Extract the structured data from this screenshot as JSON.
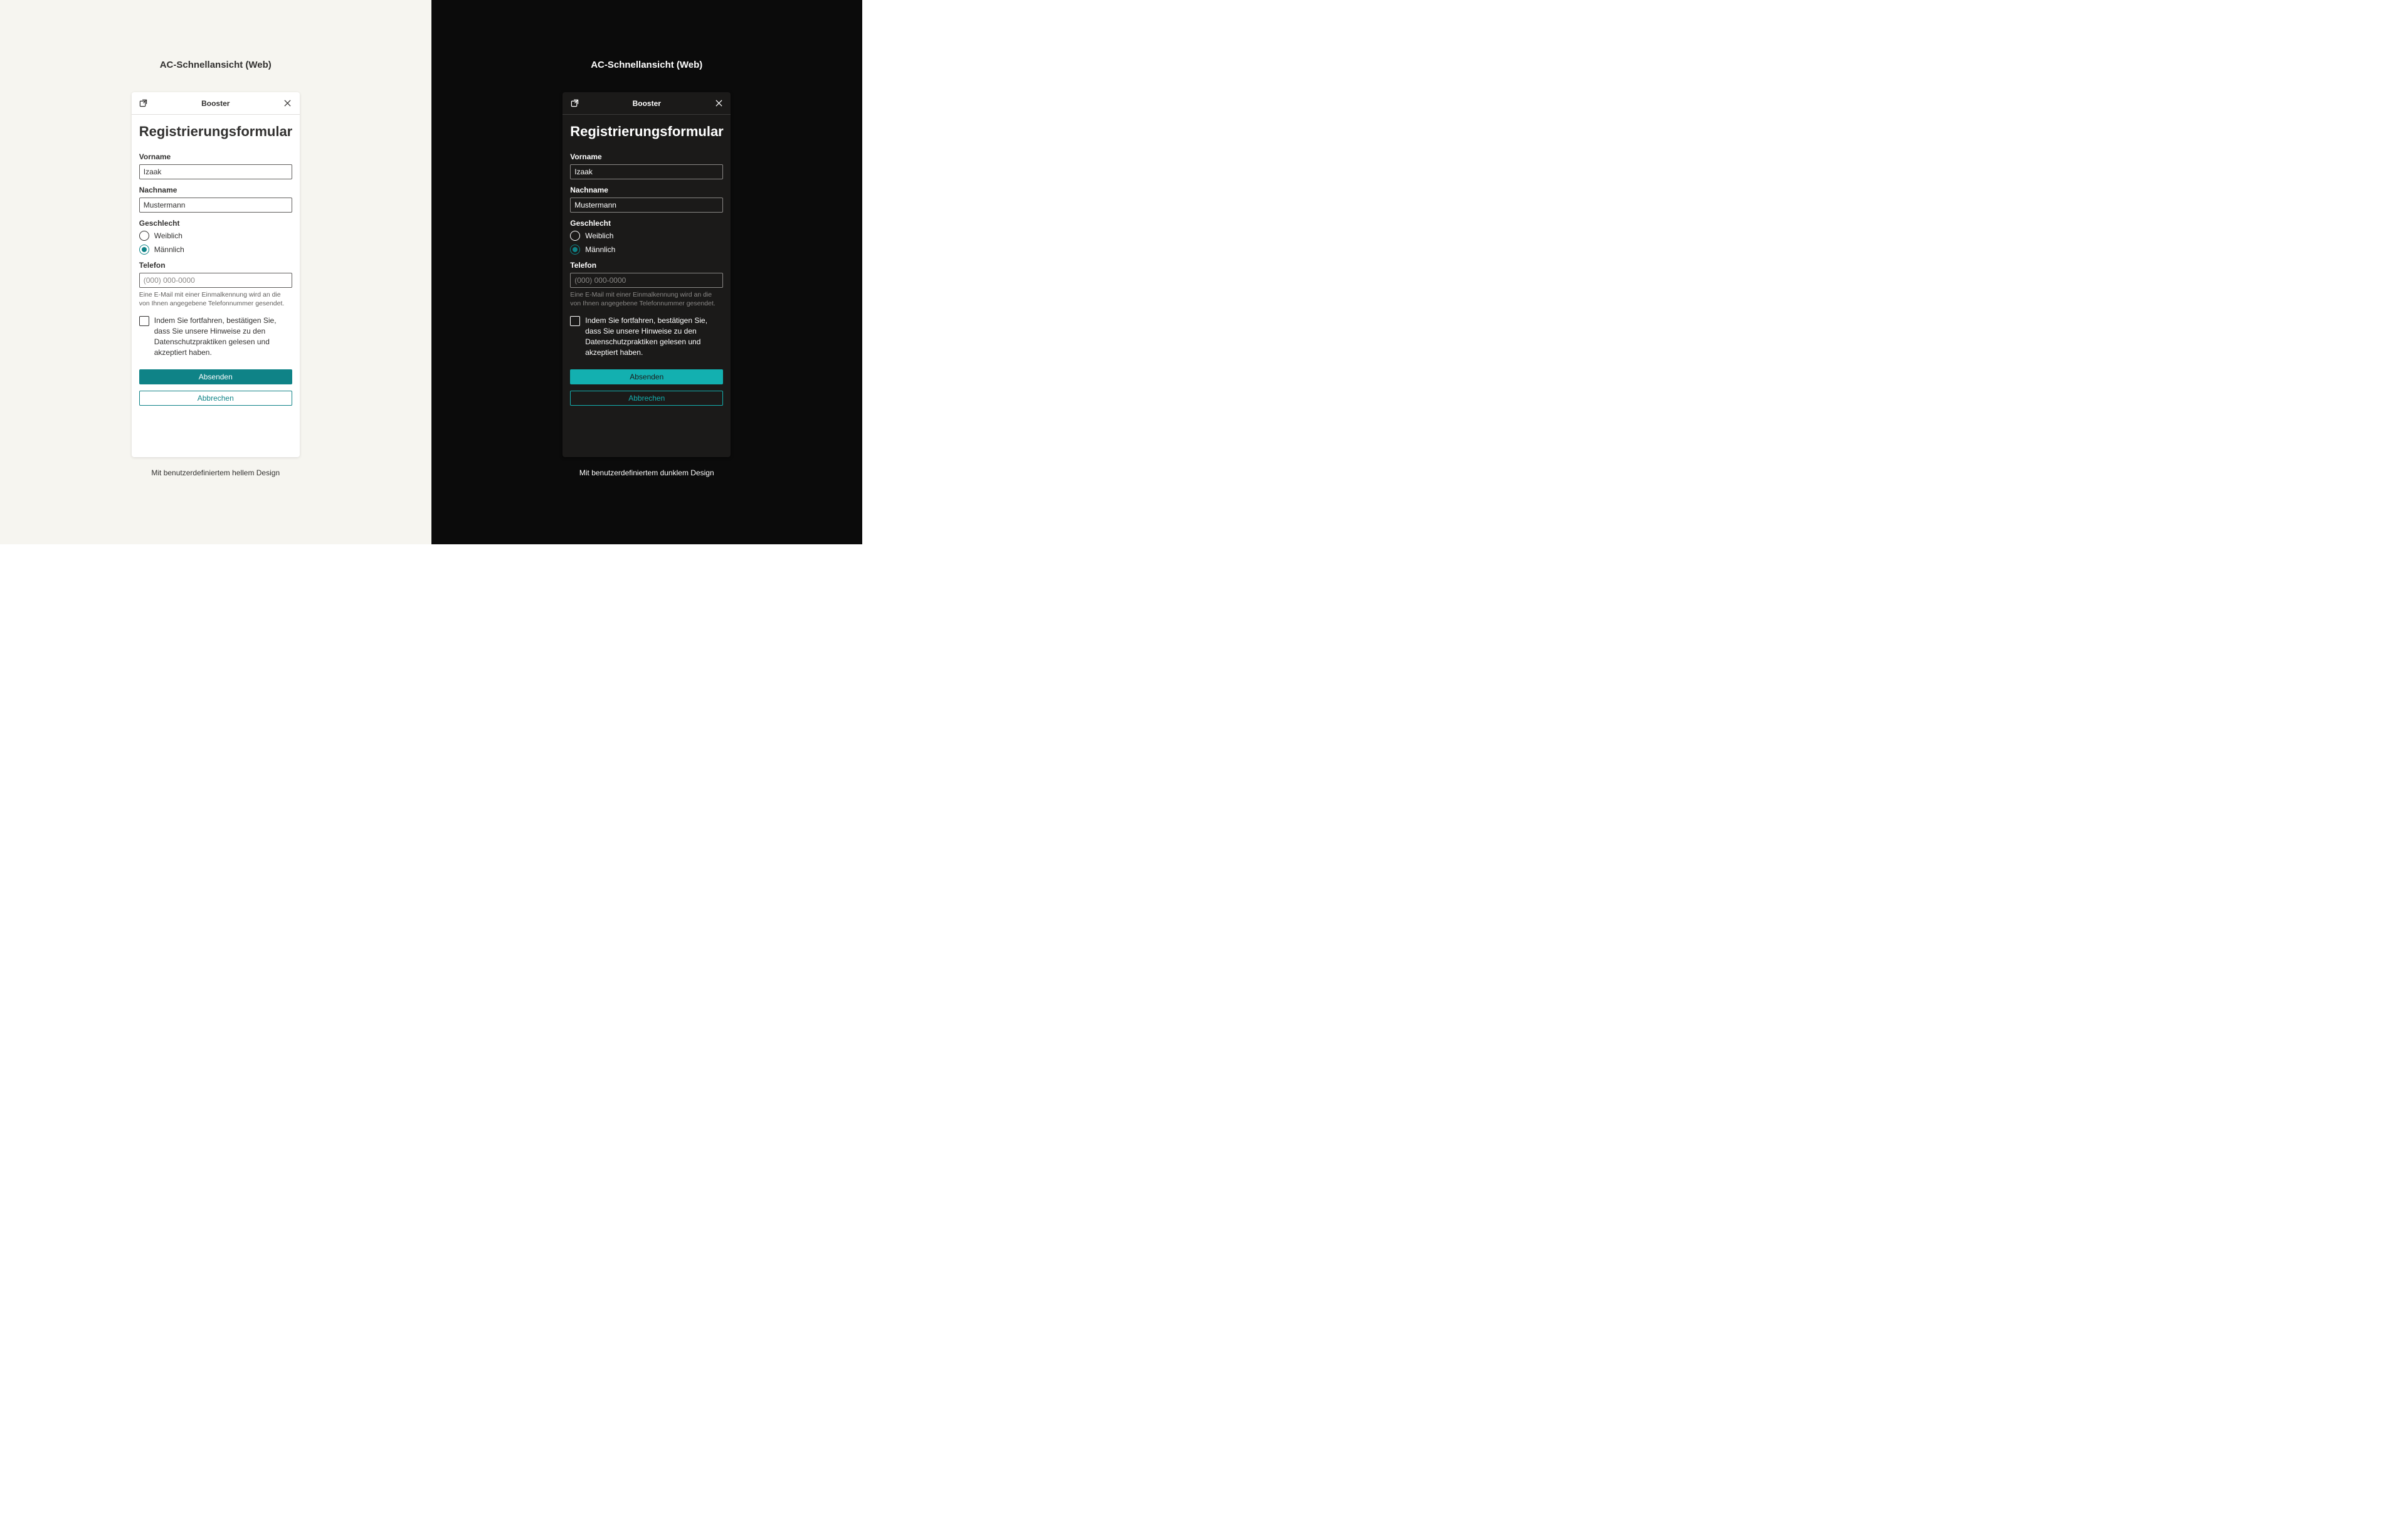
{
  "section": {
    "title": "AC-Schnellansicht (Web)"
  },
  "card": {
    "header": "Booster"
  },
  "form": {
    "heading": "Registrierungsformular",
    "first_name_label": "Vorname",
    "first_name_value": "Izaak",
    "last_name_label": "Nachname",
    "last_name_value": "Mustermann",
    "gender_label": "Geschlecht",
    "gender_options": {
      "female": "Weiblich",
      "male": "Männlich"
    },
    "gender_selected": "male",
    "phone_label": "Telefon",
    "phone_placeholder": "(000) 000-0000",
    "phone_hint": "Eine E-Mail mit einer Einmalkennung wird an die von Ihnen angegebene Telefonnummer gesendet.",
    "consent": "Indem Sie fortfahren, bestätigen Sie, dass Sie unsere Hinweise zu den Datenschutzpraktiken gelesen und akzeptiert haben.",
    "submit": "Absenden",
    "cancel": "Abbrechen"
  },
  "captions": {
    "light": "Mit benutzerdefiniertem hellem Design",
    "dark": "Mit benutzerdefiniertem dunklem Design"
  },
  "colors": {
    "accent_light": "#0f8387",
    "accent_dark": "#13b0b0"
  }
}
